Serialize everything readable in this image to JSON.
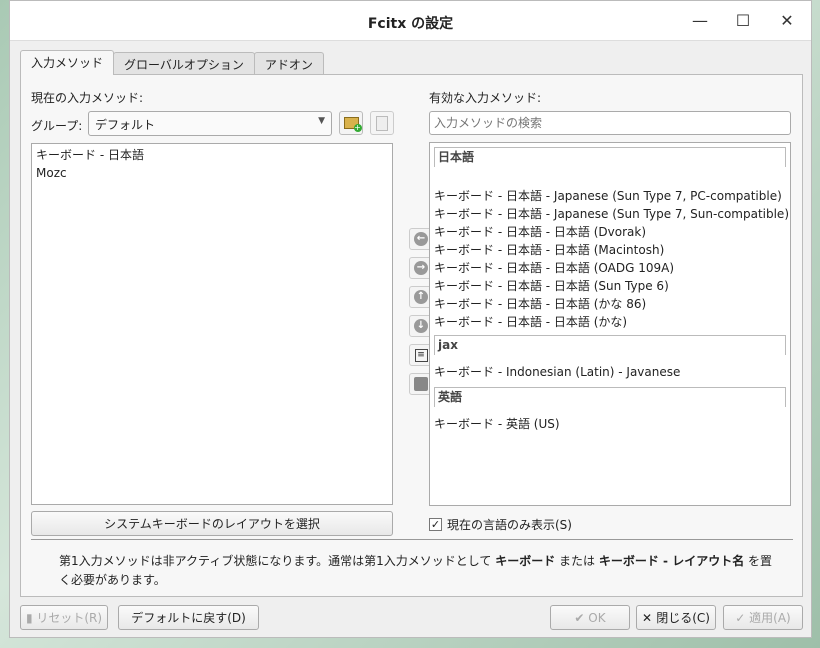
{
  "window": {
    "title": "Fcitx の設定",
    "minimize": "—",
    "maximize": "☐",
    "close": "✕"
  },
  "tabs": [
    "入力メソッド",
    "グローバルオプション",
    "アドオン"
  ],
  "left": {
    "heading": "現在の入力メソッド:",
    "group_label": "グループ:",
    "group_value": "デフォルト",
    "items": [
      "キーボード - 日本語",
      "Mozc"
    ],
    "layout_button": "システムキーボードのレイアウトを選択"
  },
  "right": {
    "heading": "有効な入力メソッド:",
    "search_placeholder": "入力メソッドの検索",
    "groups": [
      {
        "name": "日本語",
        "items": [
          "キーボード - 日本語 - Japanese (Sun Type 7, PC-compatible)",
          "キーボード - 日本語 - Japanese (Sun Type 7, Sun-compatible)",
          "キーボード - 日本語 - 日本語 (Dvorak)",
          "キーボード - 日本語 - 日本語 (Macintosh)",
          "キーボード - 日本語 - 日本語 (OADG 109A)",
          "キーボード - 日本語 - 日本語 (Sun Type 6)",
          "キーボード - 日本語 - 日本語 (かな 86)",
          "キーボード - 日本語 - 日本語 (かな)"
        ]
      },
      {
        "name": "jax",
        "items": [
          "キーボード - Indonesian (Latin) - Javanese"
        ]
      },
      {
        "name": "英語",
        "items": [
          "キーボード - 英語 (US)"
        ]
      }
    ],
    "only_current_lang": "現在の言語のみ表示(S)",
    "only_current_lang_checked": true
  },
  "info": {
    "part1": "第1入力メソッドは非アクティブ状態になります。通常は第1入力メソッドとして ",
    "bold1": "キーボード",
    "part2": " または ",
    "bold2": "キーボード - レイアウト名",
    "part3": " を置く必要があります。"
  },
  "footer": {
    "reset": "リセット(R)",
    "defaults": "デフォルトに戻す(D)",
    "ok": "OK",
    "close": "閉じる(C)",
    "apply": "適用(A)"
  }
}
